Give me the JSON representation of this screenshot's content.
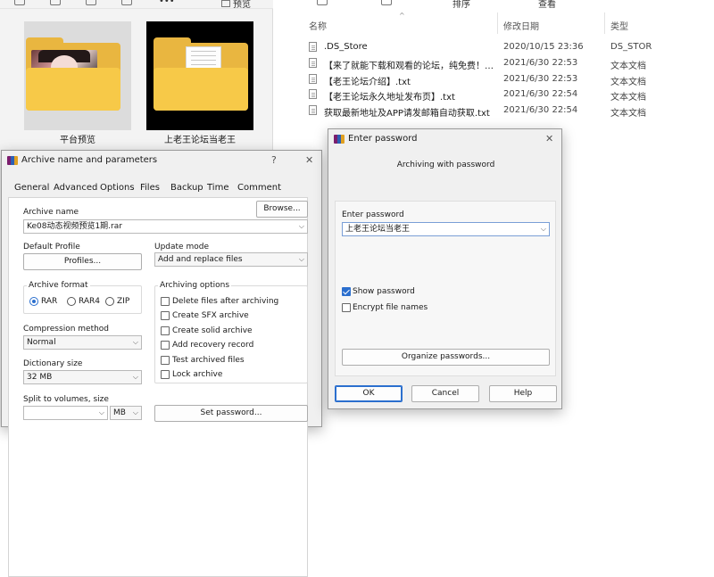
{
  "explorer": {
    "toolbar": {
      "preview_label": "预览",
      "view_label": "查看",
      "sort_label": "排序"
    },
    "thumbnails": [
      {
        "caption": "平台预览"
      },
      {
        "caption": "上老王论坛当老王"
      }
    ],
    "columns": {
      "name": "名称",
      "date": "修改日期",
      "type": "类型"
    },
    "files": [
      {
        "name": ".DS_Store",
        "date": "2020/10/15 23:36",
        "type": "DS_STOR"
      },
      {
        "name": "【来了就能下载和观看的论坛，纯免费！…",
        "date": "2021/6/30 22:53",
        "type": "文本文档"
      },
      {
        "name": "【老王论坛介绍】.txt",
        "date": "2021/6/30 22:53",
        "type": "文本文档"
      },
      {
        "name": "【老王论坛永久地址发布页】.txt",
        "date": "2021/6/30 22:54",
        "type": "文本文档"
      },
      {
        "name": "获取最新地址及APP请发邮箱自动获取.txt",
        "date": "2021/6/30 22:54",
        "type": "文本文档"
      }
    ]
  },
  "archive_dialog": {
    "title": "Archive name and parameters",
    "help_glyph": "?",
    "close_glyph": "✕",
    "tabs": [
      "General",
      "Advanced",
      "Options",
      "Files",
      "Backup",
      "Time",
      "Comment"
    ],
    "archive_name_label": "Archive name",
    "browse_label": "Browse...",
    "archive_name_value": "Ke08动态视频预览1期.rar",
    "default_profile_label": "Default Profile",
    "profiles_label": "Profiles...",
    "update_mode_label": "Update mode",
    "update_mode_value": "Add and replace files",
    "archive_format_label": "Archive format",
    "formats": [
      {
        "label": "RAR",
        "selected": true
      },
      {
        "label": "RAR4",
        "selected": false
      },
      {
        "label": "ZIP",
        "selected": false
      }
    ],
    "archiving_options_label": "Archiving options",
    "options": [
      {
        "label": "Delete files after archiving",
        "checked": false
      },
      {
        "label": "Create SFX archive",
        "checked": false
      },
      {
        "label": "Create solid archive",
        "checked": false
      },
      {
        "label": "Add recovery record",
        "checked": false
      },
      {
        "label": "Test archived files",
        "checked": false
      },
      {
        "label": "Lock archive",
        "checked": false
      }
    ],
    "compression_label": "Compression method",
    "compression_value": "Normal",
    "dictionary_label": "Dictionary size",
    "dictionary_value": "32 MB",
    "split_label": "Split to volumes, size",
    "split_value": "",
    "split_unit": "MB",
    "set_password_label": "Set password..."
  },
  "password_dialog": {
    "title": "Enter password",
    "close_glyph": "✕",
    "header": "Archiving with password",
    "enter_password_label": "Enter password",
    "password_value": "上老王论坛当老王",
    "show_password_label": "Show password",
    "show_password_checked": true,
    "encrypt_names_label": "Encrypt file names",
    "encrypt_names_checked": false,
    "organize_label": "Organize passwords...",
    "ok_label": "OK",
    "cancel_label": "Cancel",
    "help_label": "Help"
  },
  "colors": {
    "accent": "#2b6fce",
    "folder": "#f7c948",
    "dialog_bg": "#f0f0f0"
  }
}
